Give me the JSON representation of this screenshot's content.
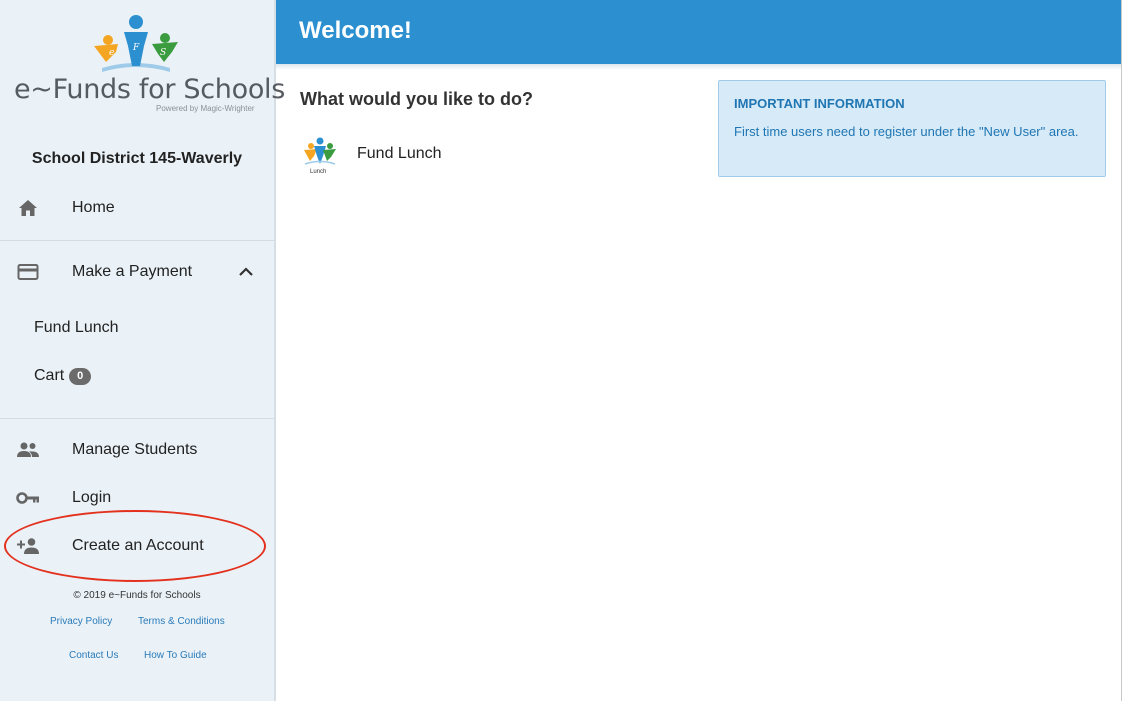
{
  "sidebar": {
    "logo_text": "e~Funds for Schools",
    "logo_sub": "Powered by Magic-Wrighter",
    "logo_letters": [
      "e",
      "F",
      "S"
    ],
    "district": "School District 145-Waverly",
    "nav": {
      "home": {
        "label": "Home",
        "icon": "home-icon"
      },
      "payment": {
        "label": "Make a Payment",
        "icon": "credit-card-icon",
        "expanded": true
      },
      "fund_lunch": {
        "label": "Fund Lunch"
      },
      "cart": {
        "label": "Cart",
        "count": "0"
      },
      "students": {
        "label": "Manage Students",
        "icon": "people-icon"
      },
      "login": {
        "label": "Login",
        "icon": "key-icon"
      },
      "create": {
        "label": "Create an Account",
        "icon": "person-add-icon",
        "highlighted": true
      }
    },
    "footer": {
      "copyright": "© 2019 e~Funds for Schools",
      "privacy": "Privacy Policy",
      "terms": "Terms & Conditions",
      "contact": "Contact Us",
      "guide": "How To Guide"
    }
  },
  "header": {
    "title": "Welcome!"
  },
  "main": {
    "prompt": "What would you like to do?",
    "fund_item": {
      "label": "Fund Lunch",
      "icon_caption": "Lunch"
    }
  },
  "info": {
    "title": "IMPORTANT INFORMATION",
    "text": "First time users need to register under the \"New User\" area."
  },
  "colors": {
    "header": "#2b8fd0",
    "sidebar": "#eaf2f8",
    "info_bg": "#d7eaf8",
    "info_text": "#1f76b3",
    "highlight": "#e3311d",
    "link": "#2a7ab8"
  }
}
